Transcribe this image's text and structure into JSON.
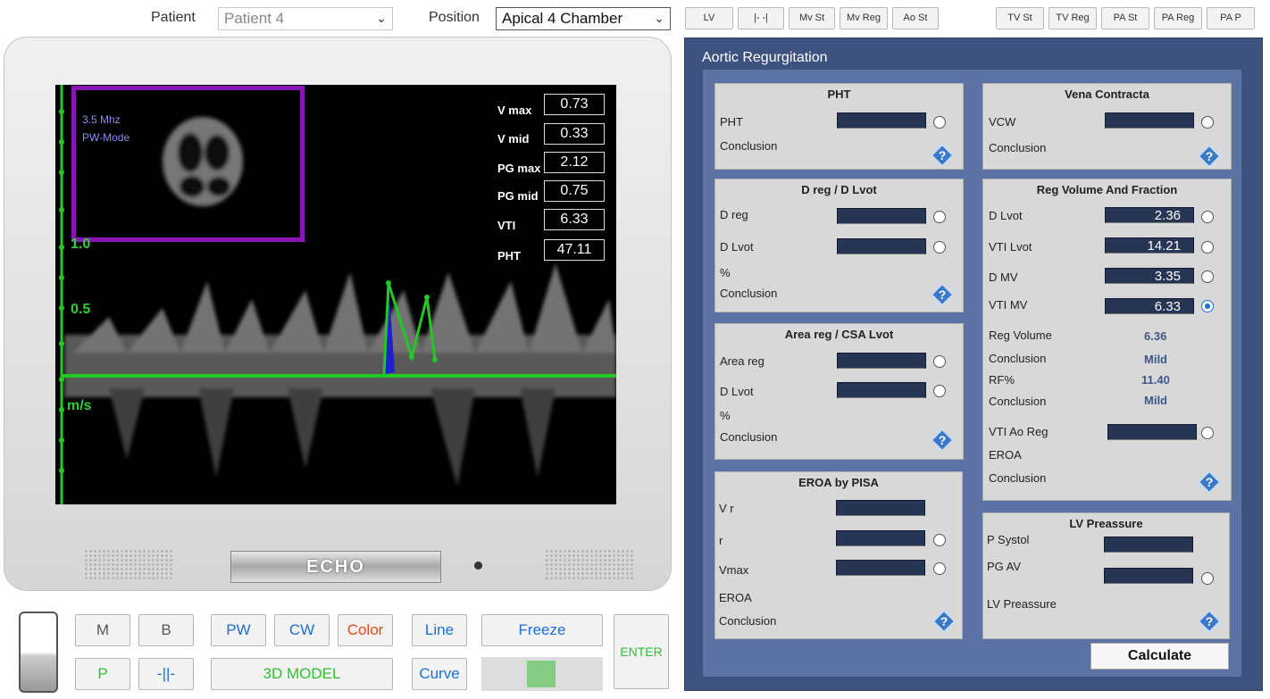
{
  "topbar": {
    "patient_label": "Patient",
    "patient_value": "Patient 4",
    "position_label": "Position",
    "position_value": "Apical 4 Chamber",
    "buttons_left": [
      "LV",
      "|- -|",
      "Mv St",
      "Mv Reg",
      "Ao St"
    ],
    "buttons_right": [
      "TV St",
      "TV Reg",
      "PA St",
      "PA Reg",
      "PA P"
    ]
  },
  "screen": {
    "frequency": "3.5 Mhz",
    "mode": "PW-Mode",
    "axis": {
      "tick_top": "1.0",
      "tick_mid": "0.5",
      "unit": "m/s"
    },
    "measurements": [
      {
        "label": "V max",
        "value": "0.73"
      },
      {
        "label": "V mid",
        "value": "0.33"
      },
      {
        "label": "PG max",
        "value": "2.12"
      },
      {
        "label": "PG mid",
        "value": "0.75"
      },
      {
        "label": "VTI",
        "value": "6.33"
      },
      {
        "label": "PHT",
        "value": "47.11"
      }
    ],
    "brand": "ECHO",
    "colors": {
      "thumb_border": "#8b16b8",
      "trace": "#2fcf2f",
      "fill": "#1f1fd0"
    }
  },
  "controls": {
    "m": "M",
    "b": "B",
    "pw": "PW",
    "cw": "CW",
    "color": "Color",
    "line": "Line",
    "freeze": "Freeze",
    "enter": "ENTER",
    "p": "P",
    "split": "-||-",
    "model3d": "3D MODEL",
    "curve": "Curve"
  },
  "panel": {
    "title": "Aortic Regurgitation",
    "pht": {
      "title": "PHT",
      "pht_label": "PHT",
      "conclusion_label": "Conclusion"
    },
    "dreg": {
      "title": "D reg / D Lvot",
      "dreg_label": "D reg",
      "dlvot_label": "D Lvot",
      "percent_label": "%",
      "conclusion_label": "Conclusion"
    },
    "area": {
      "title": "Area reg / CSA Lvot",
      "areareg_label": "Area reg",
      "dlvot_label": "D Lvot",
      "percent_label": "%",
      "conclusion_label": "Conclusion"
    },
    "eroa_pisa": {
      "title": "EROA by PISA",
      "vr_label": "V r",
      "r_label": "r",
      "vmax_label": "Vmax",
      "eroa_label": "EROA",
      "conclusion_label": "Conclusion"
    },
    "vena": {
      "title": "Vena Contracta",
      "vcw_label": "VCW",
      "conclusion_label": "Conclusion"
    },
    "regvol": {
      "title": "Reg Volume And Fraction",
      "dlvot_label": "D Lvot",
      "dlvot_value": "2.36",
      "vtilvot_label": "VTI Lvot",
      "vtilvot_value": "14.21",
      "dmv_label": "D MV",
      "dmv_value": "3.35",
      "vtimv_label": "VTI MV",
      "vtimv_value": "6.33",
      "regvolume_label": "Reg Volume",
      "regvolume_value": "6.36",
      "conclusion1_label": "Conclusion",
      "conclusion1_value": "Mild",
      "rf_label": "RF%",
      "rf_value": "11.40",
      "conclusion2_label": "Conclusion",
      "conclusion2_value": "Mild",
      "vtiaoreg_label": "VTI Ao Reg",
      "eroa_label": "EROA",
      "conclusion3_label": "Conclusion"
    },
    "lvp": {
      "title": "LV Preassure",
      "psystol_label": "P Systol",
      "pgav_label": "PG AV",
      "lvp_label": "LV Preassure"
    },
    "calculate_label": "Calculate"
  }
}
